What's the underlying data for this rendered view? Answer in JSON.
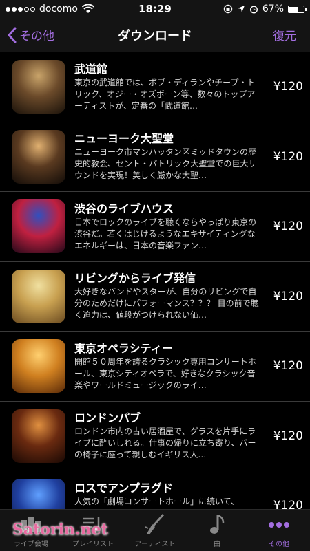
{
  "status": {
    "carrier": "docomo",
    "time": "18:29",
    "battery": "67%",
    "battery_level": 0.67
  },
  "nav": {
    "back_label": "その他",
    "title": "ダウンロード",
    "restore_label": "復元"
  },
  "items": [
    {
      "title": "武道館",
      "desc": "東京の武道館では、ボブ・ディランやチープ・トリック、オジー・オズボーン等、数々のトップアーティストが、定番の「武道館…",
      "price": "¥120",
      "thumb_colors": [
        "#c9a46a",
        "#6b4a2a",
        "#1a120a"
      ]
    },
    {
      "title": "ニューヨーク大聖堂",
      "desc": "ニューヨーク市マンハッタン区ミッドタウンの歴史的教会、セント・パトリック大聖堂での巨大サウンドを実現！美しく厳かな大聖…",
      "price": "¥120",
      "thumb_colors": [
        "#e0b070",
        "#5a3a20",
        "#120c08"
      ]
    },
    {
      "title": "渋谷のライブハウス",
      "desc": "日本でロックのライブを聴くならやっぱり東京の渋谷だ。若くはじけるようなエキサイティングなエネルギーは、日本の音楽ファン…",
      "price": "¥120",
      "thumb_colors": [
        "#3050c0",
        "#c02040",
        "#200818"
      ]
    },
    {
      "title": "リビングからライブ発信",
      "desc": "大好きなバンドやスターが、自分のリビングで自分のためだけにパフォーマンス？？？ 目の前で聴く迫力は、値段がつけられない価…",
      "price": "¥120",
      "thumb_colors": [
        "#f0e0a0",
        "#c8a050",
        "#6a4a20"
      ]
    },
    {
      "title": "東京オペラシティー",
      "desc": "開館５０周年を誇るクラシック専用コンサートホール、東京シティオペラで、好きなクラシック音楽やワールドミュージックのライ…",
      "price": "¥120",
      "thumb_colors": [
        "#ffd070",
        "#d08020",
        "#5a2a08"
      ]
    },
    {
      "title": "ロンドンパブ",
      "desc": "ロンドン市内の古い居酒屋で、グラスを片手にライブに酔いしれる。仕事の帰りに立ち寄り、バーの椅子に座って親しむイギリス人…",
      "price": "¥120",
      "thumb_colors": [
        "#e09040",
        "#6a2a10",
        "#180804"
      ]
    },
    {
      "title": "ロスでアンプラグド",
      "desc": "人気の「劇場コンサートホール」に続いて、",
      "price": "¥120",
      "thumb_colors": [
        "#60a0ff",
        "#2040a0",
        "#0a1030"
      ]
    }
  ],
  "tabs": [
    {
      "label": "ライブ会場",
      "icon": "venue-icon",
      "active": false
    },
    {
      "label": "プレイリスト",
      "icon": "playlist-icon",
      "active": false
    },
    {
      "label": "アーティスト",
      "icon": "guitar-icon",
      "active": false
    },
    {
      "label": "曲",
      "icon": "music-note-icon",
      "active": false
    },
    {
      "label": "その他",
      "icon": "more-icon",
      "active": true
    }
  ],
  "watermark": "Satorin.net",
  "colors": {
    "accent": "#a36ee0",
    "background": "#000000",
    "bar": "#141414"
  }
}
